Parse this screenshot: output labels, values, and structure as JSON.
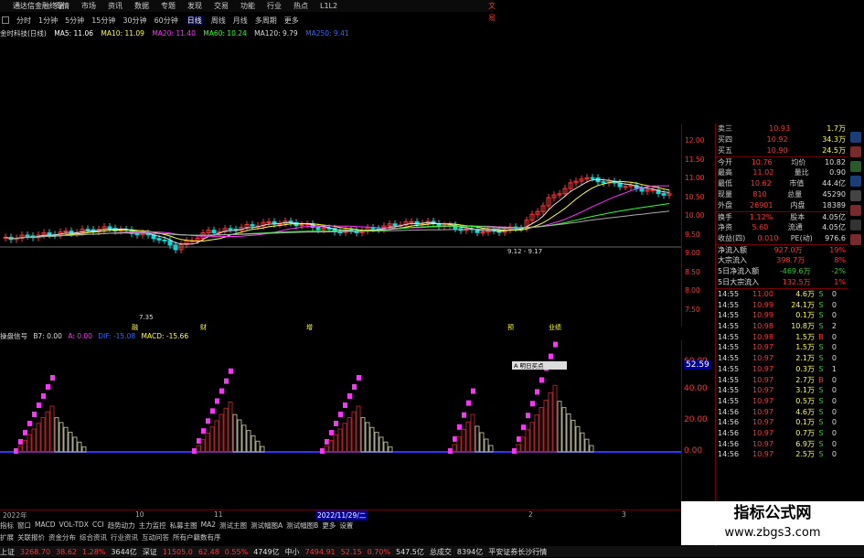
{
  "window": {
    "title": "通达信金融终端",
    "tab_label": "文易"
  },
  "menu": [
    "行情",
    "市场",
    "资讯",
    "数据",
    "专题",
    "发现",
    "交易",
    "功能",
    "行业",
    "热点",
    "L1L2"
  ],
  "toolbar": {
    "items": [
      "分时",
      "1分钟",
      "5分钟",
      "15分钟",
      "30分钟",
      "60分钟",
      "日线",
      "周线",
      "月线",
      "多周期",
      "更多"
    ],
    "active_index": 6
  },
  "stock_info": {
    "name": "金时科技(日线)",
    "ma5": "MA5: 11.06",
    "ma10": "MA10: 11.09",
    "ma20": "MA20: 11.40",
    "ma60": "MA60: 10.24",
    "ma120": "MA120: 9.79",
    "ma250": "MA250: 9.41"
  },
  "main_chart": {
    "min_label": "7.35",
    "range_label": "9.12 - 9.17",
    "event_labels": [
      "融",
      "财",
      "增",
      "预",
      "业绩"
    ]
  },
  "right_axis": {
    "ticks": [
      "12.00",
      "11.50",
      "11.00",
      "10.50",
      "10.00",
      "9.50",
      "9.00",
      "8.50",
      "8.00",
      "7.50"
    ]
  },
  "sub_chart": {
    "header": [
      "操盘信号",
      "B7: 0.00",
      "A: 0.00",
      "DIF: -15.08",
      "MACD: -15.66"
    ],
    "tooltip": "A 明日买点",
    "axis_value": "52.59",
    "axis_ticks": [
      "60.00",
      "40.00",
      "20.00",
      "0.00"
    ]
  },
  "date_bar": {
    "labels": [
      "2022年",
      "10",
      "11",
      "2022/11/29/二",
      "2",
      "3"
    ]
  },
  "bottom_tabs": [
    "指标",
    "窗口",
    "MACD",
    "VOL-TDX",
    "CCI",
    "趋势动力",
    "主力监控",
    "私募主图",
    "MA2",
    "测试主图",
    "测试幅图A",
    "测试幅图B",
    "更多",
    "设置"
  ],
  "bottom_tabs2": [
    "扩展",
    "关联报价",
    "资金分布",
    "综合资讯",
    "行业资讯",
    "互动问答",
    "所有户籍数有序"
  ],
  "quote_panel": {
    "rows": [
      {
        "label": "卖三",
        "price": "10.93",
        "vol": "1.7万"
      },
      {
        "label": "买四",
        "price": "10.92",
        "vol": "34.3万"
      },
      {
        "label": "买五",
        "price": "10.90",
        "vol": "24.5万"
      },
      {
        "label": "今开",
        "price": "10.76",
        "label2": "均价",
        "value2": "10.82"
      },
      {
        "label": "最高",
        "price": "11.02",
        "label2": "量比",
        "value2": "0.90"
      },
      {
        "label": "最低",
        "price": "10.62",
        "label2": "市值",
        "value2": "44.4亿"
      },
      {
        "label": "现量",
        "price": "810",
        "label2": "总量",
        "value2": "45290"
      },
      {
        "label": "外盘",
        "price": "26901",
        "label2": "内盘",
        "value2": "18389"
      },
      {
        "label": "换手",
        "price": "1.12%",
        "label2": "股本",
        "value2": "4.05亿"
      },
      {
        "label": "净资",
        "price": "5.60",
        "label2": "流通",
        "value2": "4.05亿"
      },
      {
        "label": "收益(四)",
        "price": "0.010",
        "label2": "PE(动)",
        "value2": "976.6"
      }
    ],
    "flows": [
      {
        "label": "净流入额",
        "value": "927.0万",
        "pct": "19%"
      },
      {
        "label": "大宗流入",
        "value": "398.7万",
        "pct": "8%"
      },
      {
        "label": "5日净流入额",
        "value": "-469.6万",
        "pct": "-2%"
      },
      {
        "label": "5日大宗流入",
        "value": "132.5万",
        "pct": "1%"
      }
    ],
    "ticks": [
      {
        "time": "14:55",
        "price": "11.00",
        "vol": "4.6万",
        "side": "S",
        "n": "0"
      },
      {
        "time": "14:55",
        "price": "10.99",
        "vol": "24.1万",
        "side": "S",
        "n": "0"
      },
      {
        "time": "14:55",
        "price": "10.99",
        "vol": "0.1万",
        "side": "S",
        "n": "0"
      },
      {
        "time": "14:55",
        "price": "10.98",
        "vol": "10.8万",
        "side": "S",
        "n": "2"
      },
      {
        "time": "14:55",
        "price": "10.98",
        "vol": "1.5万",
        "side": "B",
        "n": "0"
      },
      {
        "time": "14:55",
        "price": "10.97",
        "vol": "1.5万",
        "side": "S",
        "n": "0"
      },
      {
        "time": "14:55",
        "price": "10.97",
        "vol": "2.1万",
        "side": "S",
        "n": "0"
      },
      {
        "time": "14:55",
        "price": "10.97",
        "vol": "0.3万",
        "side": "S",
        "n": "1"
      },
      {
        "time": "14:55",
        "price": "10.97",
        "vol": "2.7万",
        "side": "B",
        "n": "0"
      },
      {
        "time": "14:55",
        "price": "10.97",
        "vol": "3.1万",
        "side": "S",
        "n": "0"
      },
      {
        "time": "14:55",
        "price": "10.97",
        "vol": "0.5万",
        "side": "S",
        "n": "0"
      },
      {
        "time": "14:56",
        "price": "10.97",
        "vol": "4.6万",
        "side": "S",
        "n": "0"
      },
      {
        "time": "14:56",
        "price": "10.97",
        "vol": "0.1万",
        "side": "S",
        "n": "0"
      },
      {
        "time": "14:56",
        "price": "10.97",
        "vol": "0.7万",
        "side": "S",
        "n": "0"
      },
      {
        "time": "14:56",
        "price": "10.97",
        "vol": "6.9万",
        "side": "S",
        "n": "0"
      },
      {
        "time": "14:56",
        "price": "10.97",
        "vol": "2.5万",
        "side": "S",
        "n": "0"
      }
    ],
    "footer": "图文F10"
  },
  "status_bar": {
    "items": [
      {
        "name": "上证",
        "value": "3268.70",
        "chg": "38.62",
        "pct": "1.28%",
        "amt": "3644亿"
      },
      {
        "name": "深证",
        "value": "11505.0",
        "chg": "62.48",
        "pct": "0.55%",
        "amt": "4749亿"
      },
      {
        "name": "中小",
        "value": "7494.91",
        "chg": "52.15",
        "pct": "0.70%",
        "amt": "547.5亿"
      }
    ],
    "total_label": "总成交",
    "total_value": "8394亿",
    "broker": "平安证券长沙行情"
  },
  "watermark": {
    "line1": "指标公式网",
    "line2": "www.zbgs3.com"
  },
  "colors": {
    "up": "#ff3333",
    "down": "#00d4d4",
    "ma5": "#ffffff",
    "ma10": "#ffff00",
    "ma20": "#ff00ff",
    "ma60": "#00ff00",
    "pink": "#ff33ff"
  }
}
